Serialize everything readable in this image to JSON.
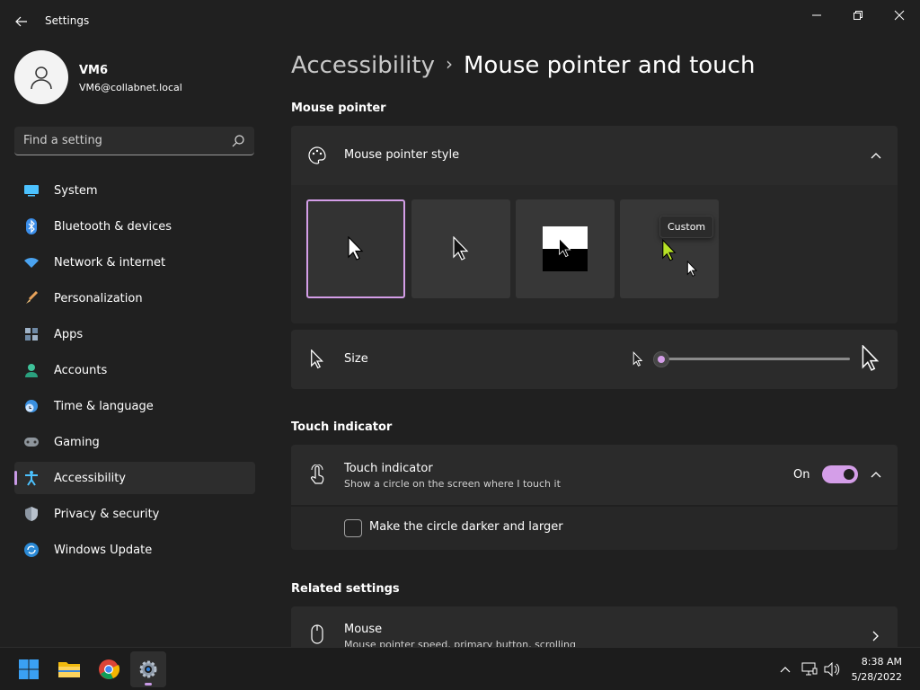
{
  "window": {
    "title": "Settings"
  },
  "profile": {
    "name": "VM6",
    "email": "VM6@collabnet.local"
  },
  "search": {
    "placeholder": "Find a setting"
  },
  "sidebar": {
    "items": [
      {
        "label": "System",
        "icon": "monitor-icon"
      },
      {
        "label": "Bluetooth & devices",
        "icon": "bluetooth-icon"
      },
      {
        "label": "Network & internet",
        "icon": "wifi-icon"
      },
      {
        "label": "Personalization",
        "icon": "brush-icon"
      },
      {
        "label": "Apps",
        "icon": "apps-icon"
      },
      {
        "label": "Accounts",
        "icon": "person-icon"
      },
      {
        "label": "Time & language",
        "icon": "clock-globe-icon"
      },
      {
        "label": "Gaming",
        "icon": "gamepad-icon"
      },
      {
        "label": "Accessibility",
        "icon": "accessibility-icon",
        "active": true
      },
      {
        "label": "Privacy & security",
        "icon": "shield-icon"
      },
      {
        "label": "Windows Update",
        "icon": "refresh-icon"
      }
    ]
  },
  "breadcrumb": {
    "parent": "Accessibility",
    "separator": "›",
    "current": "Mouse pointer and touch"
  },
  "mouse_pointer": {
    "section_title": "Mouse pointer",
    "style_label": "Mouse pointer style",
    "styles": [
      "White",
      "Black",
      "Inverted",
      "Custom"
    ],
    "selected_style": "White",
    "tooltip": "Custom",
    "size_label": "Size",
    "size_value": 1
  },
  "touch_indicator": {
    "section_title": "Touch indicator",
    "label": "Touch indicator",
    "description": "Show a circle on the screen where I touch it",
    "state_label": "On",
    "enabled": true,
    "checkbox_label": "Make the circle darker and larger",
    "checkbox_checked": false
  },
  "related": {
    "section_title": "Related settings",
    "mouse_label": "Mouse",
    "mouse_description": "Mouse pointer speed, primary button, scrolling"
  },
  "taskbar": {
    "apps": [
      "start-icon",
      "file-explorer-icon",
      "chrome-icon",
      "settings-icon"
    ],
    "time": "8:38 AM",
    "date": "5/28/2022"
  },
  "colors": {
    "accent": "#d49ee8",
    "background": "#202020",
    "card": "#2b2b2b"
  }
}
